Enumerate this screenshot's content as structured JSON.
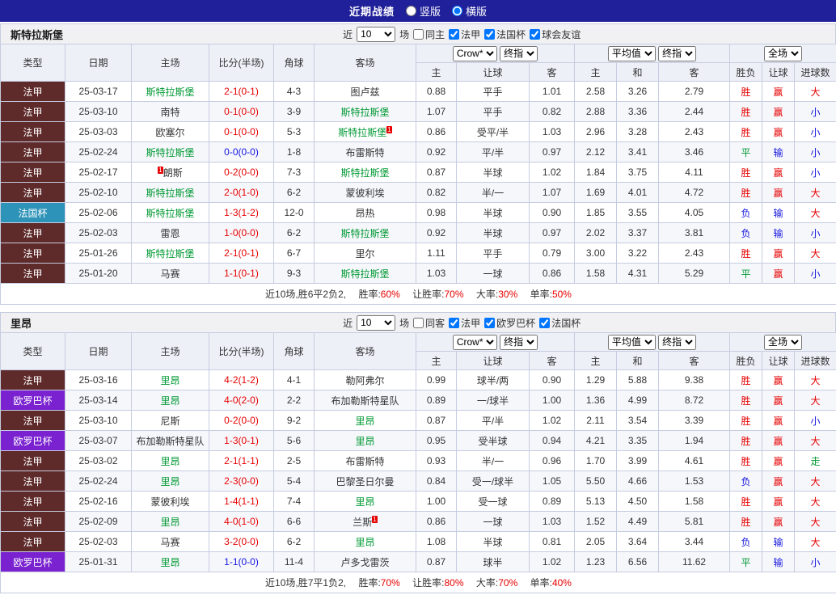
{
  "header": {
    "title": "近期战绩",
    "radios": [
      {
        "label": "竖版",
        "checked": false
      },
      {
        "label": "横版",
        "checked": true
      }
    ]
  },
  "sections": [
    {
      "team": "斯特拉斯堡",
      "filter": {
        "near": "近",
        "count": "10",
        "games": "场",
        "same": {
          "label": "同主",
          "checked": false
        },
        "leagues": [
          {
            "label": "法甲",
            "checked": true
          },
          {
            "label": "法国杯",
            "checked": true
          },
          {
            "label": "球会友谊",
            "checked": true
          }
        ]
      },
      "table": {
        "cols": [
          "类型",
          "日期",
          "主场",
          "比分(半场)",
          "角球",
          "客场"
        ],
        "selects": [
          "Crow*",
          "终指",
          "平均值",
          "终指",
          "全场"
        ],
        "subcols": [
          "主",
          "让球",
          "客",
          "主",
          "和",
          "客",
          "胜负",
          "让球",
          "进球数"
        ]
      },
      "rows": [
        {
          "league": "法甲",
          "lg": "ligue1",
          "date": "25-03-17",
          "home": {
            "name": "斯特拉斯堡",
            "hl": true
          },
          "score": {
            "text": "2-1(0-1)",
            "c": "red"
          },
          "corner": "4-3",
          "away": {
            "name": "图卢兹",
            "hl": false
          },
          "odds": [
            "0.88",
            "平手",
            "1.01",
            "2.58",
            "3.26",
            "2.79"
          ],
          "res": [
            {
              "t": "胜",
              "c": "red"
            },
            {
              "t": "赢",
              "c": "red"
            },
            {
              "t": "大",
              "c": "red"
            }
          ]
        },
        {
          "league": "法甲",
          "lg": "ligue1",
          "date": "25-03-10",
          "home": {
            "name": "南特",
            "hl": false
          },
          "score": {
            "text": "0-1(0-0)",
            "c": "red"
          },
          "corner": "3-9",
          "away": {
            "name": "斯特拉斯堡",
            "hl": true
          },
          "odds": [
            "1.07",
            "平手",
            "0.82",
            "2.88",
            "3.36",
            "2.44"
          ],
          "res": [
            {
              "t": "胜",
              "c": "red"
            },
            {
              "t": "赢",
              "c": "red"
            },
            {
              "t": "小",
              "c": "blue"
            }
          ]
        },
        {
          "league": "法甲",
          "lg": "ligue1",
          "date": "25-03-03",
          "home": {
            "name": "欧塞尔",
            "hl": false
          },
          "score": {
            "text": "0-1(0-0)",
            "c": "red"
          },
          "corner": "5-3",
          "away": {
            "name": "斯特拉斯堡",
            "hl": true,
            "sup": "1"
          },
          "odds": [
            "0.86",
            "受平/半",
            "1.03",
            "2.96",
            "3.28",
            "2.43"
          ],
          "res": [
            {
              "t": "胜",
              "c": "red"
            },
            {
              "t": "赢",
              "c": "red"
            },
            {
              "t": "小",
              "c": "blue"
            }
          ]
        },
        {
          "league": "法甲",
          "lg": "ligue1",
          "date": "25-02-24",
          "home": {
            "name": "斯特拉斯堡",
            "hl": true
          },
          "score": {
            "text": "0-0(0-0)",
            "c": "blue"
          },
          "corner": "1-8",
          "away": {
            "name": "布雷斯特",
            "hl": false
          },
          "odds": [
            "0.92",
            "平/半",
            "0.97",
            "2.12",
            "3.41",
            "3.46"
          ],
          "res": [
            {
              "t": "平",
              "c": "green"
            },
            {
              "t": "输",
              "c": "blue"
            },
            {
              "t": "小",
              "c": "blue"
            }
          ]
        },
        {
          "league": "法甲",
          "lg": "ligue1",
          "date": "25-02-17",
          "home": {
            "name": "朗斯",
            "hl": false,
            "sup_pre": "1"
          },
          "score": {
            "text": "0-2(0-0)",
            "c": "red"
          },
          "corner": "7-3",
          "away": {
            "name": "斯特拉斯堡",
            "hl": true
          },
          "odds": [
            "0.87",
            "半球",
            "1.02",
            "1.84",
            "3.75",
            "4.11"
          ],
          "res": [
            {
              "t": "胜",
              "c": "red"
            },
            {
              "t": "赢",
              "c": "red"
            },
            {
              "t": "小",
              "c": "blue"
            }
          ]
        },
        {
          "league": "法甲",
          "lg": "ligue1",
          "date": "25-02-10",
          "home": {
            "name": "斯特拉斯堡",
            "hl": true
          },
          "score": {
            "text": "2-0(1-0)",
            "c": "red"
          },
          "corner": "6-2",
          "away": {
            "name": "蒙彼利埃",
            "hl": false
          },
          "odds": [
            "0.82",
            "半/一",
            "1.07",
            "1.69",
            "4.01",
            "4.72"
          ],
          "res": [
            {
              "t": "胜",
              "c": "red"
            },
            {
              "t": "赢",
              "c": "red"
            },
            {
              "t": "大",
              "c": "red"
            }
          ]
        },
        {
          "league": "法国杯",
          "lg": "cupfr",
          "date": "25-02-06",
          "home": {
            "name": "斯特拉斯堡",
            "hl": true
          },
          "score": {
            "text": "1-3(1-2)",
            "c": "red"
          },
          "corner": "12-0",
          "away": {
            "name": "昂热",
            "hl": false
          },
          "odds": [
            "0.98",
            "半球",
            "0.90",
            "1.85",
            "3.55",
            "4.05"
          ],
          "res": [
            {
              "t": "负",
              "c": "blue"
            },
            {
              "t": "输",
              "c": "blue"
            },
            {
              "t": "大",
              "c": "red"
            }
          ]
        },
        {
          "league": "法甲",
          "lg": "ligue1",
          "date": "25-02-03",
          "home": {
            "name": "雷恩",
            "hl": false
          },
          "score": {
            "text": "1-0(0-0)",
            "c": "red"
          },
          "corner": "6-2",
          "away": {
            "name": "斯特拉斯堡",
            "hl": true
          },
          "odds": [
            "0.92",
            "半球",
            "0.97",
            "2.02",
            "3.37",
            "3.81"
          ],
          "res": [
            {
              "t": "负",
              "c": "blue"
            },
            {
              "t": "输",
              "c": "blue"
            },
            {
              "t": "小",
              "c": "blue"
            }
          ]
        },
        {
          "league": "法甲",
          "lg": "ligue1",
          "date": "25-01-26",
          "home": {
            "name": "斯特拉斯堡",
            "hl": true
          },
          "score": {
            "text": "2-1(0-1)",
            "c": "red"
          },
          "corner": "6-7",
          "away": {
            "name": "里尔",
            "hl": false
          },
          "odds": [
            "1.11",
            "平手",
            "0.79",
            "3.00",
            "3.22",
            "2.43"
          ],
          "res": [
            {
              "t": "胜",
              "c": "red"
            },
            {
              "t": "赢",
              "c": "red"
            },
            {
              "t": "大",
              "c": "red"
            }
          ]
        },
        {
          "league": "法甲",
          "lg": "ligue1",
          "date": "25-01-20",
          "home": {
            "name": "马赛",
            "hl": false
          },
          "score": {
            "text": "1-1(0-1)",
            "c": "red"
          },
          "corner": "9-3",
          "away": {
            "name": "斯特拉斯堡",
            "hl": true
          },
          "odds": [
            "1.03",
            "一球",
            "0.86",
            "1.58",
            "4.31",
            "5.29"
          ],
          "res": [
            {
              "t": "平",
              "c": "green"
            },
            {
              "t": "赢",
              "c": "red"
            },
            {
              "t": "小",
              "c": "blue"
            }
          ]
        }
      ],
      "summary": {
        "prefix": "近10场,胜6平2负2,",
        "stats": [
          {
            "label": "胜率:",
            "value": "60%"
          },
          {
            "label": "让胜率:",
            "value": "70%"
          },
          {
            "label": "大率:",
            "value": "30%"
          },
          {
            "label": "单率:",
            "value": "50%"
          }
        ]
      }
    },
    {
      "team": "里昂",
      "filter": {
        "near": "近",
        "count": "10",
        "games": "场",
        "same": {
          "label": "同客",
          "checked": false
        },
        "leagues": [
          {
            "label": "法甲",
            "checked": true
          },
          {
            "label": "欧罗巴杯",
            "checked": true
          },
          {
            "label": "法国杯",
            "checked": true
          }
        ]
      },
      "table": {
        "cols": [
          "类型",
          "日期",
          "主场",
          "比分(半场)",
          "角球",
          "客场"
        ],
        "selects": [
          "Crow*",
          "终指",
          "平均值",
          "终指",
          "全场"
        ],
        "subcols": [
          "主",
          "让球",
          "客",
          "主",
          "和",
          "客",
          "胜负",
          "让球",
          "进球数"
        ]
      },
      "rows": [
        {
          "league": "法甲",
          "lg": "ligue1",
          "date": "25-03-16",
          "home": {
            "name": "里昂",
            "hl": true
          },
          "score": {
            "text": "4-2(1-2)",
            "c": "red"
          },
          "corner": "4-1",
          "away": {
            "name": "勒阿弗尔",
            "hl": false
          },
          "odds": [
            "0.99",
            "球半/两",
            "0.90",
            "1.29",
            "5.88",
            "9.38"
          ],
          "res": [
            {
              "t": "胜",
              "c": "red"
            },
            {
              "t": "赢",
              "c": "red"
            },
            {
              "t": "大",
              "c": "red"
            }
          ]
        },
        {
          "league": "欧罗巴杯",
          "lg": "europa",
          "date": "25-03-14",
          "home": {
            "name": "里昂",
            "hl": true
          },
          "score": {
            "text": "4-0(2-0)",
            "c": "red"
          },
          "corner": "2-2",
          "away": {
            "name": "布加勒斯特星队",
            "hl": false
          },
          "odds": [
            "0.89",
            "一/球半",
            "1.00",
            "1.36",
            "4.99",
            "8.72"
          ],
          "res": [
            {
              "t": "胜",
              "c": "red"
            },
            {
              "t": "赢",
              "c": "red"
            },
            {
              "t": "大",
              "c": "red"
            }
          ]
        },
        {
          "league": "法甲",
          "lg": "ligue1",
          "date": "25-03-10",
          "home": {
            "name": "尼斯",
            "hl": false
          },
          "score": {
            "text": "0-2(0-0)",
            "c": "red"
          },
          "corner": "9-2",
          "away": {
            "name": "里昂",
            "hl": true
          },
          "odds": [
            "0.87",
            "平/半",
            "1.02",
            "2.11",
            "3.54",
            "3.39"
          ],
          "res": [
            {
              "t": "胜",
              "c": "red"
            },
            {
              "t": "赢",
              "c": "red"
            },
            {
              "t": "小",
              "c": "blue"
            }
          ]
        },
        {
          "league": "欧罗巴杯",
          "lg": "europa",
          "date": "25-03-07",
          "home": {
            "name": "布加勒斯特星队",
            "hl": false
          },
          "score": {
            "text": "1-3(0-1)",
            "c": "red"
          },
          "corner": "5-6",
          "away": {
            "name": "里昂",
            "hl": true
          },
          "odds": [
            "0.95",
            "受半球",
            "0.94",
            "4.21",
            "3.35",
            "1.94"
          ],
          "res": [
            {
              "t": "胜",
              "c": "red"
            },
            {
              "t": "赢",
              "c": "red"
            },
            {
              "t": "大",
              "c": "red"
            }
          ]
        },
        {
          "league": "法甲",
          "lg": "ligue1",
          "date": "25-03-02",
          "home": {
            "name": "里昂",
            "hl": true
          },
          "score": {
            "text": "2-1(1-1)",
            "c": "red"
          },
          "corner": "2-5",
          "away": {
            "name": "布雷斯特",
            "hl": false
          },
          "odds": [
            "0.93",
            "半/一",
            "0.96",
            "1.70",
            "3.99",
            "4.61"
          ],
          "res": [
            {
              "t": "胜",
              "c": "red"
            },
            {
              "t": "赢",
              "c": "red"
            },
            {
              "t": "走",
              "c": "green"
            }
          ]
        },
        {
          "league": "法甲",
          "lg": "ligue1",
          "date": "25-02-24",
          "home": {
            "name": "里昂",
            "hl": true
          },
          "score": {
            "text": "2-3(0-0)",
            "c": "red"
          },
          "corner": "5-4",
          "away": {
            "name": "巴黎圣日尔曼",
            "hl": false
          },
          "odds": [
            "0.84",
            "受一/球半",
            "1.05",
            "5.50",
            "4.66",
            "1.53"
          ],
          "res": [
            {
              "t": "负",
              "c": "blue"
            },
            {
              "t": "赢",
              "c": "red"
            },
            {
              "t": "大",
              "c": "red"
            }
          ]
        },
        {
          "league": "法甲",
          "lg": "ligue1",
          "date": "25-02-16",
          "home": {
            "name": "蒙彼利埃",
            "hl": false
          },
          "score": {
            "text": "1-4(1-1)",
            "c": "red"
          },
          "corner": "7-4",
          "away": {
            "name": "里昂",
            "hl": true
          },
          "odds": [
            "1.00",
            "受一球",
            "0.89",
            "5.13",
            "4.50",
            "1.58"
          ],
          "res": [
            {
              "t": "胜",
              "c": "red"
            },
            {
              "t": "赢",
              "c": "red"
            },
            {
              "t": "大",
              "c": "red"
            }
          ]
        },
        {
          "league": "法甲",
          "lg": "ligue1",
          "date": "25-02-09",
          "home": {
            "name": "里昂",
            "hl": true
          },
          "score": {
            "text": "4-0(1-0)",
            "c": "red"
          },
          "corner": "6-6",
          "away": {
            "name": "兰斯",
            "hl": false,
            "sup": "1"
          },
          "odds": [
            "0.86",
            "一球",
            "1.03",
            "1.52",
            "4.49",
            "5.81"
          ],
          "res": [
            {
              "t": "胜",
              "c": "red"
            },
            {
              "t": "赢",
              "c": "red"
            },
            {
              "t": "大",
              "c": "red"
            }
          ]
        },
        {
          "league": "法甲",
          "lg": "ligue1",
          "date": "25-02-03",
          "home": {
            "name": "马赛",
            "hl": false
          },
          "score": {
            "text": "3-2(0-0)",
            "c": "red"
          },
          "corner": "6-2",
          "away": {
            "name": "里昂",
            "hl": true
          },
          "odds": [
            "1.08",
            "半球",
            "0.81",
            "2.05",
            "3.64",
            "3.44"
          ],
          "res": [
            {
              "t": "负",
              "c": "blue"
            },
            {
              "t": "输",
              "c": "blue"
            },
            {
              "t": "大",
              "c": "red"
            }
          ]
        },
        {
          "league": "欧罗巴杯",
          "lg": "europa",
          "date": "25-01-31",
          "home": {
            "name": "里昂",
            "hl": true
          },
          "score": {
            "text": "1-1(0-0)",
            "c": "blue"
          },
          "corner": "11-4",
          "away": {
            "name": "卢多戈雷茨",
            "hl": false
          },
          "odds": [
            "0.87",
            "球半",
            "1.02",
            "1.23",
            "6.56",
            "11.62"
          ],
          "res": [
            {
              "t": "平",
              "c": "green"
            },
            {
              "t": "输",
              "c": "blue"
            },
            {
              "t": "小",
              "c": "blue"
            }
          ]
        }
      ],
      "summary": {
        "prefix": "近10场,胜7平1负2,",
        "stats": [
          {
            "label": "胜率:",
            "value": "70%"
          },
          {
            "label": "让胜率:",
            "value": "80%"
          },
          {
            "label": "大率:",
            "value": "70%"
          },
          {
            "label": "单率:",
            "value": "40%"
          }
        ]
      }
    }
  ]
}
